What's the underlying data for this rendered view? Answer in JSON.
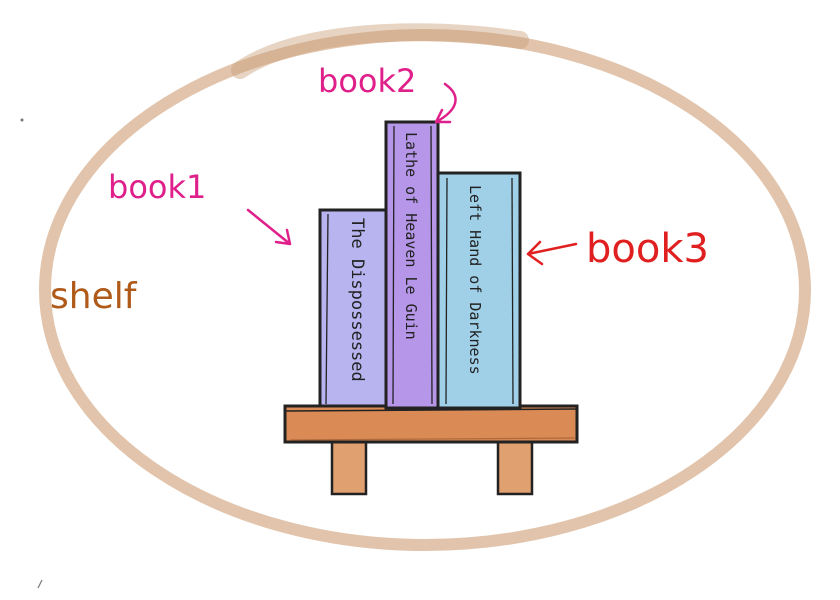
{
  "labels": {
    "shelf": "shelf",
    "book1": "book1",
    "book2": "book2",
    "book3": "book3"
  },
  "books": [
    {
      "id": "book1",
      "spine_title": "The Dispossessed",
      "color": "#b8b4f0"
    },
    {
      "id": "book2",
      "spine_title": "Lathe of Heaven   Le Guin",
      "color": "#b596e8"
    },
    {
      "id": "book3",
      "spine_title": "Left Hand of Darkness",
      "color": "#9fd0e8"
    }
  ],
  "colors": {
    "oval": "#d9b596",
    "shelf_wood": "#d98a55",
    "shelf_leg": "#e0a070",
    "ink": "#222222",
    "label_magenta": "#e0208a",
    "label_red": "#e02020",
    "label_brown": "#b05a1a"
  }
}
